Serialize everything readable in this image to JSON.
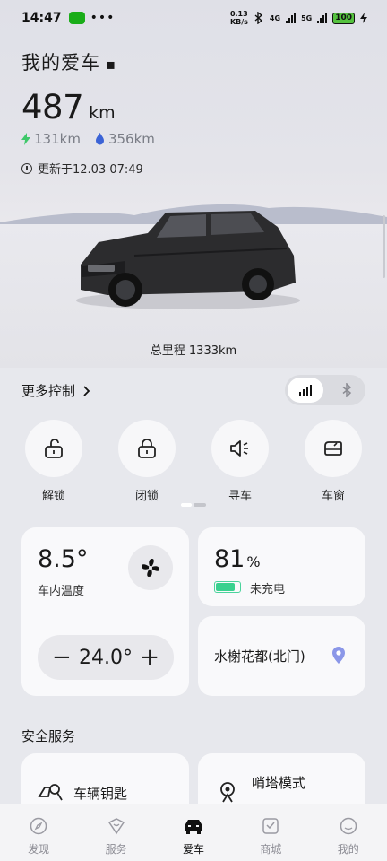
{
  "status_bar": {
    "time": "14:47",
    "net_speed_top": "0.13",
    "net_speed_bottom": "KB/s",
    "signal1": "4G",
    "signal2": "5G",
    "battery": "100"
  },
  "header": {
    "title": "我的爱车"
  },
  "range": {
    "total": "487",
    "unit": "km",
    "electric": "131km",
    "fuel": "356km",
    "updated": "更新于12.03 07:49"
  },
  "odometer": "总里程 1333km",
  "more_control": {
    "label": "更多控制"
  },
  "controls": [
    {
      "label": "解锁",
      "icon": "unlock-icon"
    },
    {
      "label": "闭锁",
      "icon": "lock-icon"
    },
    {
      "label": "寻车",
      "icon": "horn-icon"
    },
    {
      "label": "车窗",
      "icon": "window-icon"
    }
  ],
  "climate": {
    "inside_temp": "8.5°",
    "inside_label": "车内温度",
    "target_temp": "24.0°",
    "minus": "−",
    "plus": "+"
  },
  "charge": {
    "soc": "81",
    "pct": "%",
    "status": "未充电",
    "level": 0.81
  },
  "location": {
    "name": "水榭花都(北门)"
  },
  "safety": {
    "title": "安全服务",
    "items": [
      {
        "label": "车辆钥匙"
      },
      {
        "label": "哨塔模式"
      }
    ]
  },
  "tabs": [
    {
      "label": "发现",
      "icon": "compass-icon"
    },
    {
      "label": "服务",
      "icon": "service-icon"
    },
    {
      "label": "爱车",
      "icon": "car-icon"
    },
    {
      "label": "商城",
      "icon": "shop-icon"
    },
    {
      "label": "我的",
      "icon": "profile-icon"
    }
  ],
  "colors": {
    "accent": "#111111",
    "electric": "#3ec86a",
    "fuel": "#3b63d6",
    "battery_fill": "#39d18f",
    "pin": "#8b97e8"
  }
}
